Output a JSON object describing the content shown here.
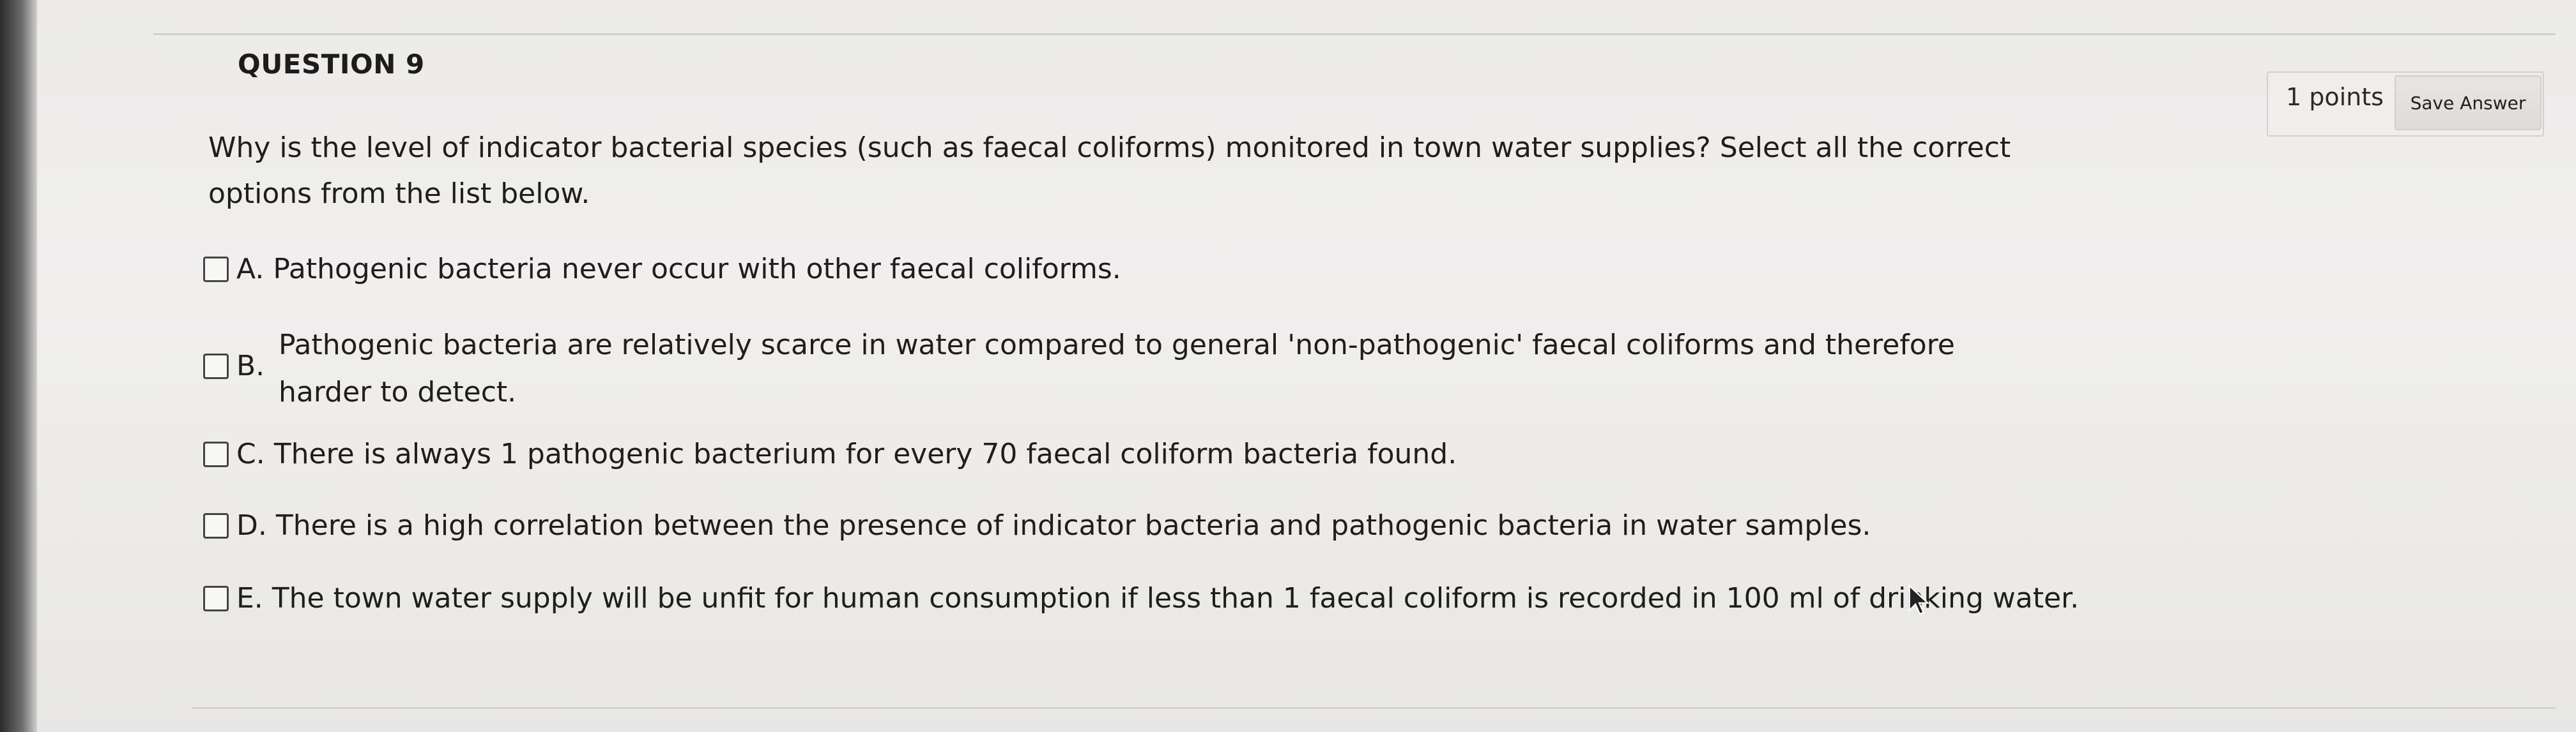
{
  "question": {
    "title": "QUESTION 9",
    "points": "1 points",
    "save_label": "Save Answer",
    "text": "Why is the level of indicator bacterial species (such as faecal coliforms) monitored in town water supplies? Select all the correct options from the list below."
  },
  "options": [
    {
      "letter": "A.",
      "text": "Pathogenic bacteria never occur with other faecal coliforms.",
      "checked": false
    },
    {
      "letter": "B.",
      "text": "Pathogenic bacteria are relatively scarce in water compared to general 'non-pathogenic' faecal coliforms and therefore harder to detect.",
      "checked": false
    },
    {
      "letter": "C.",
      "text": "There is always 1 pathogenic bacterium for every 70 faecal coliform bacteria found.",
      "checked": false
    },
    {
      "letter": "D.",
      "text": "There is a high correlation between the presence of indicator bacteria and pathogenic bacteria in water samples.",
      "checked": false
    },
    {
      "letter": "E.",
      "text": "The town water supply will be unfit for human consumption if less than 1 faecal coliform is recorded in 100 ml of drinking water.",
      "checked": false
    }
  ],
  "icons": {
    "cursor": "mouse-pointer-icon",
    "checkbox": "checkbox-unchecked-icon"
  },
  "colors": {
    "background": "#ecebea",
    "text": "#1e1e1e",
    "button_bg": "#e2e1df"
  }
}
